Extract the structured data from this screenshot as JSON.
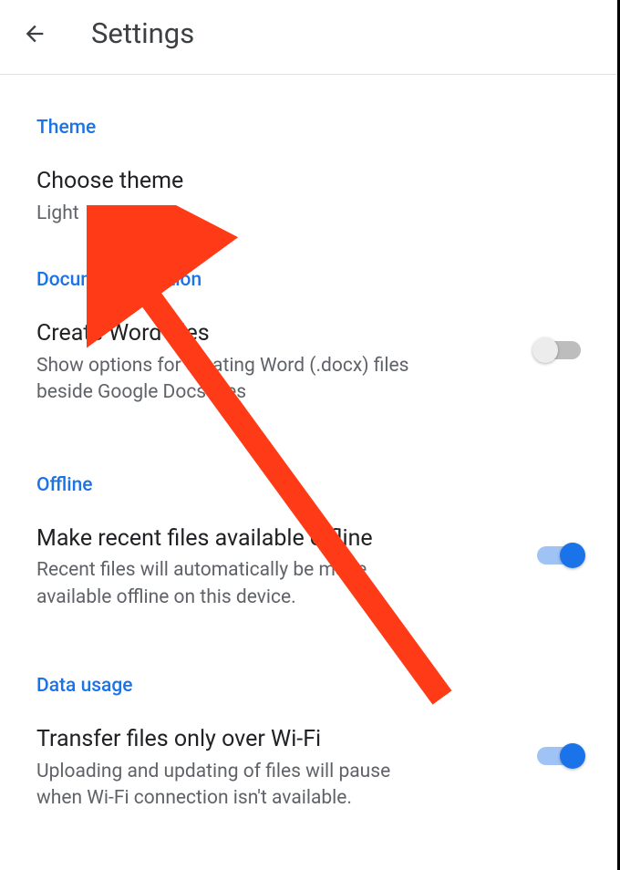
{
  "header": {
    "title": "Settings"
  },
  "sections": {
    "theme": {
      "label": "Theme",
      "choose_theme": {
        "title": "Choose theme",
        "value": "Light"
      }
    },
    "document_creation": {
      "label": "Document Creation",
      "create_word": {
        "title": "Create Word files",
        "subtitle": "Show options for creating Word (.docx) files beside Google Docs files",
        "enabled": false
      }
    },
    "offline": {
      "label": "Offline",
      "make_available": {
        "title": "Make recent files available offline",
        "subtitle": "Recent files will automatically be made available offline on this device.",
        "enabled": true
      }
    },
    "data_usage": {
      "label": "Data usage",
      "transfer": {
        "title": "Transfer files only over Wi-Fi",
        "subtitle": "Uploading and updating of files will pause when Wi-Fi connection isn't available.",
        "enabled": true
      }
    }
  },
  "colors": {
    "accent": "#1a73e8",
    "annotation": "#ff3b17"
  }
}
